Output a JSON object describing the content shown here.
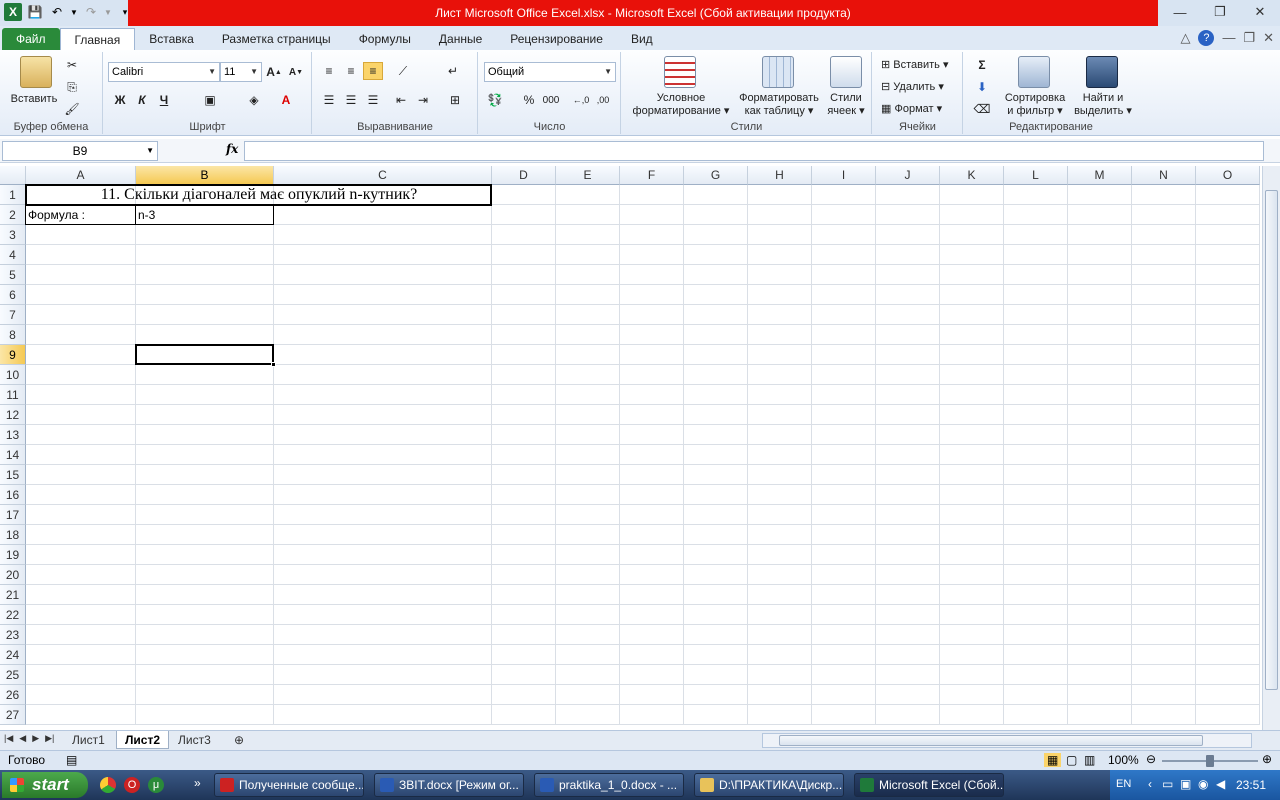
{
  "window": {
    "title": "Лист Microsoft Office Excel.xlsx  -  Microsoft Excel (Сбой активации продукта)"
  },
  "tabs": [
    {
      "label": "Файл"
    },
    {
      "label": "Главная"
    },
    {
      "label": "Вставка"
    },
    {
      "label": "Разметка страницы"
    },
    {
      "label": "Формулы"
    },
    {
      "label": "Данные"
    },
    {
      "label": "Рецензирование"
    },
    {
      "label": "Вид"
    }
  ],
  "ribbon": {
    "clipboard": {
      "label": "Буфер обмена",
      "paste": "Вставить"
    },
    "font": {
      "label": "Шрифт",
      "name": "Calibri",
      "size": "11",
      "bold": "Ж",
      "italic": "К",
      "underline": "Ч"
    },
    "alignment": {
      "label": "Выравнивание"
    },
    "number": {
      "label": "Число",
      "format": "Общий"
    },
    "styles": {
      "label": "Стили",
      "cond1": "Условное",
      "cond2": "форматирование",
      "table1": "Форматировать",
      "table2": "как таблицу",
      "cell1": "Стили",
      "cell2": "ячеек"
    },
    "cells": {
      "label": "Ячейки",
      "insert": "Вставить",
      "delete": "Удалить",
      "format": "Формат"
    },
    "editing": {
      "label": "Редактирование",
      "sort1": "Сортировка",
      "sort2": "и фильтр",
      "find1": "Найти и",
      "find2": "выделить"
    }
  },
  "formula_bar": {
    "name_box": "B9",
    "fx": "fx",
    "content": ""
  },
  "columns": [
    "A",
    "B",
    "C",
    "D",
    "E",
    "F",
    "G",
    "H",
    "I",
    "J",
    "K",
    "L",
    "M",
    "N",
    "O"
  ],
  "rows": [
    "1",
    "2",
    "3",
    "4",
    "5",
    "6",
    "7",
    "8",
    "9",
    "10",
    "11",
    "12",
    "13",
    "14",
    "15",
    "16",
    "17",
    "18",
    "19",
    "20",
    "21",
    "22",
    "23",
    "24",
    "25",
    "26",
    "27"
  ],
  "cells": {
    "a1": "11. Скільки діагоналей має опуклий n-кутник?",
    "a2": "Формула :",
    "b2": "n-3"
  },
  "sheets": [
    {
      "label": "Лист1"
    },
    {
      "label": "Лист2"
    },
    {
      "label": "Лист3"
    }
  ],
  "status": {
    "ready": "Готово",
    "zoom": "100%"
  },
  "taskbar": {
    "start": "start",
    "items": [
      {
        "label": "Полученные сообще..."
      },
      {
        "label": "ЗВІТ.docx [Режим ог..."
      },
      {
        "label": "praktika_1_0.docx - ..."
      },
      {
        "label": "D:\\ПРАКТИКА\\Дискр..."
      },
      {
        "label": "Microsoft Excel (Сбой..."
      }
    ],
    "lang": "EN",
    "time": "23:51"
  }
}
